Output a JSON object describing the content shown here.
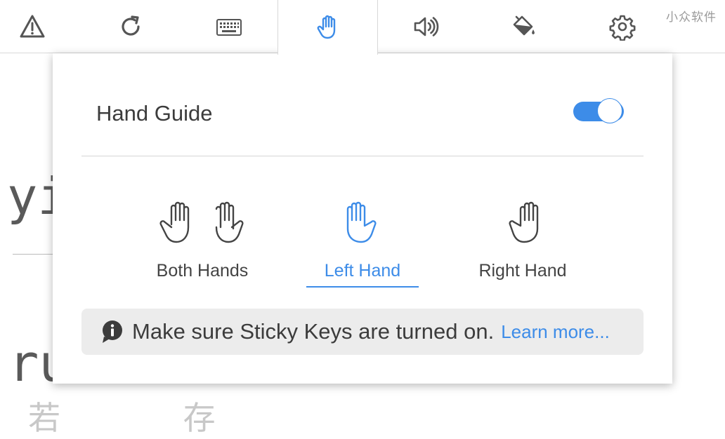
{
  "toolbar": {
    "items": [
      {
        "icon": "warning-icon"
      },
      {
        "icon": "refresh-icon"
      },
      {
        "icon": "keyboard-icon"
      },
      {
        "icon": "hand-icon",
        "active": true
      },
      {
        "icon": "speaker-icon"
      },
      {
        "icon": "paint-bucket-icon"
      },
      {
        "icon": "gear-icon"
      }
    ],
    "watermark": "小众软件"
  },
  "background": {
    "pinyin_1": "yi",
    "pinyin_2": "ru",
    "hanzi": "若 存"
  },
  "hand_guide": {
    "title": "Hand Guide",
    "enabled": true,
    "options": [
      {
        "label": "Both Hands",
        "selected": false
      },
      {
        "label": "Left Hand",
        "selected": true
      },
      {
        "label": "Right Hand",
        "selected": false
      }
    ],
    "info_text": "Make sure Sticky Keys are turned on.",
    "info_link": "Learn more..."
  },
  "colors": {
    "accent": "#3d8ce8",
    "icon_gray": "#555555",
    "info_bg": "#ececec"
  }
}
